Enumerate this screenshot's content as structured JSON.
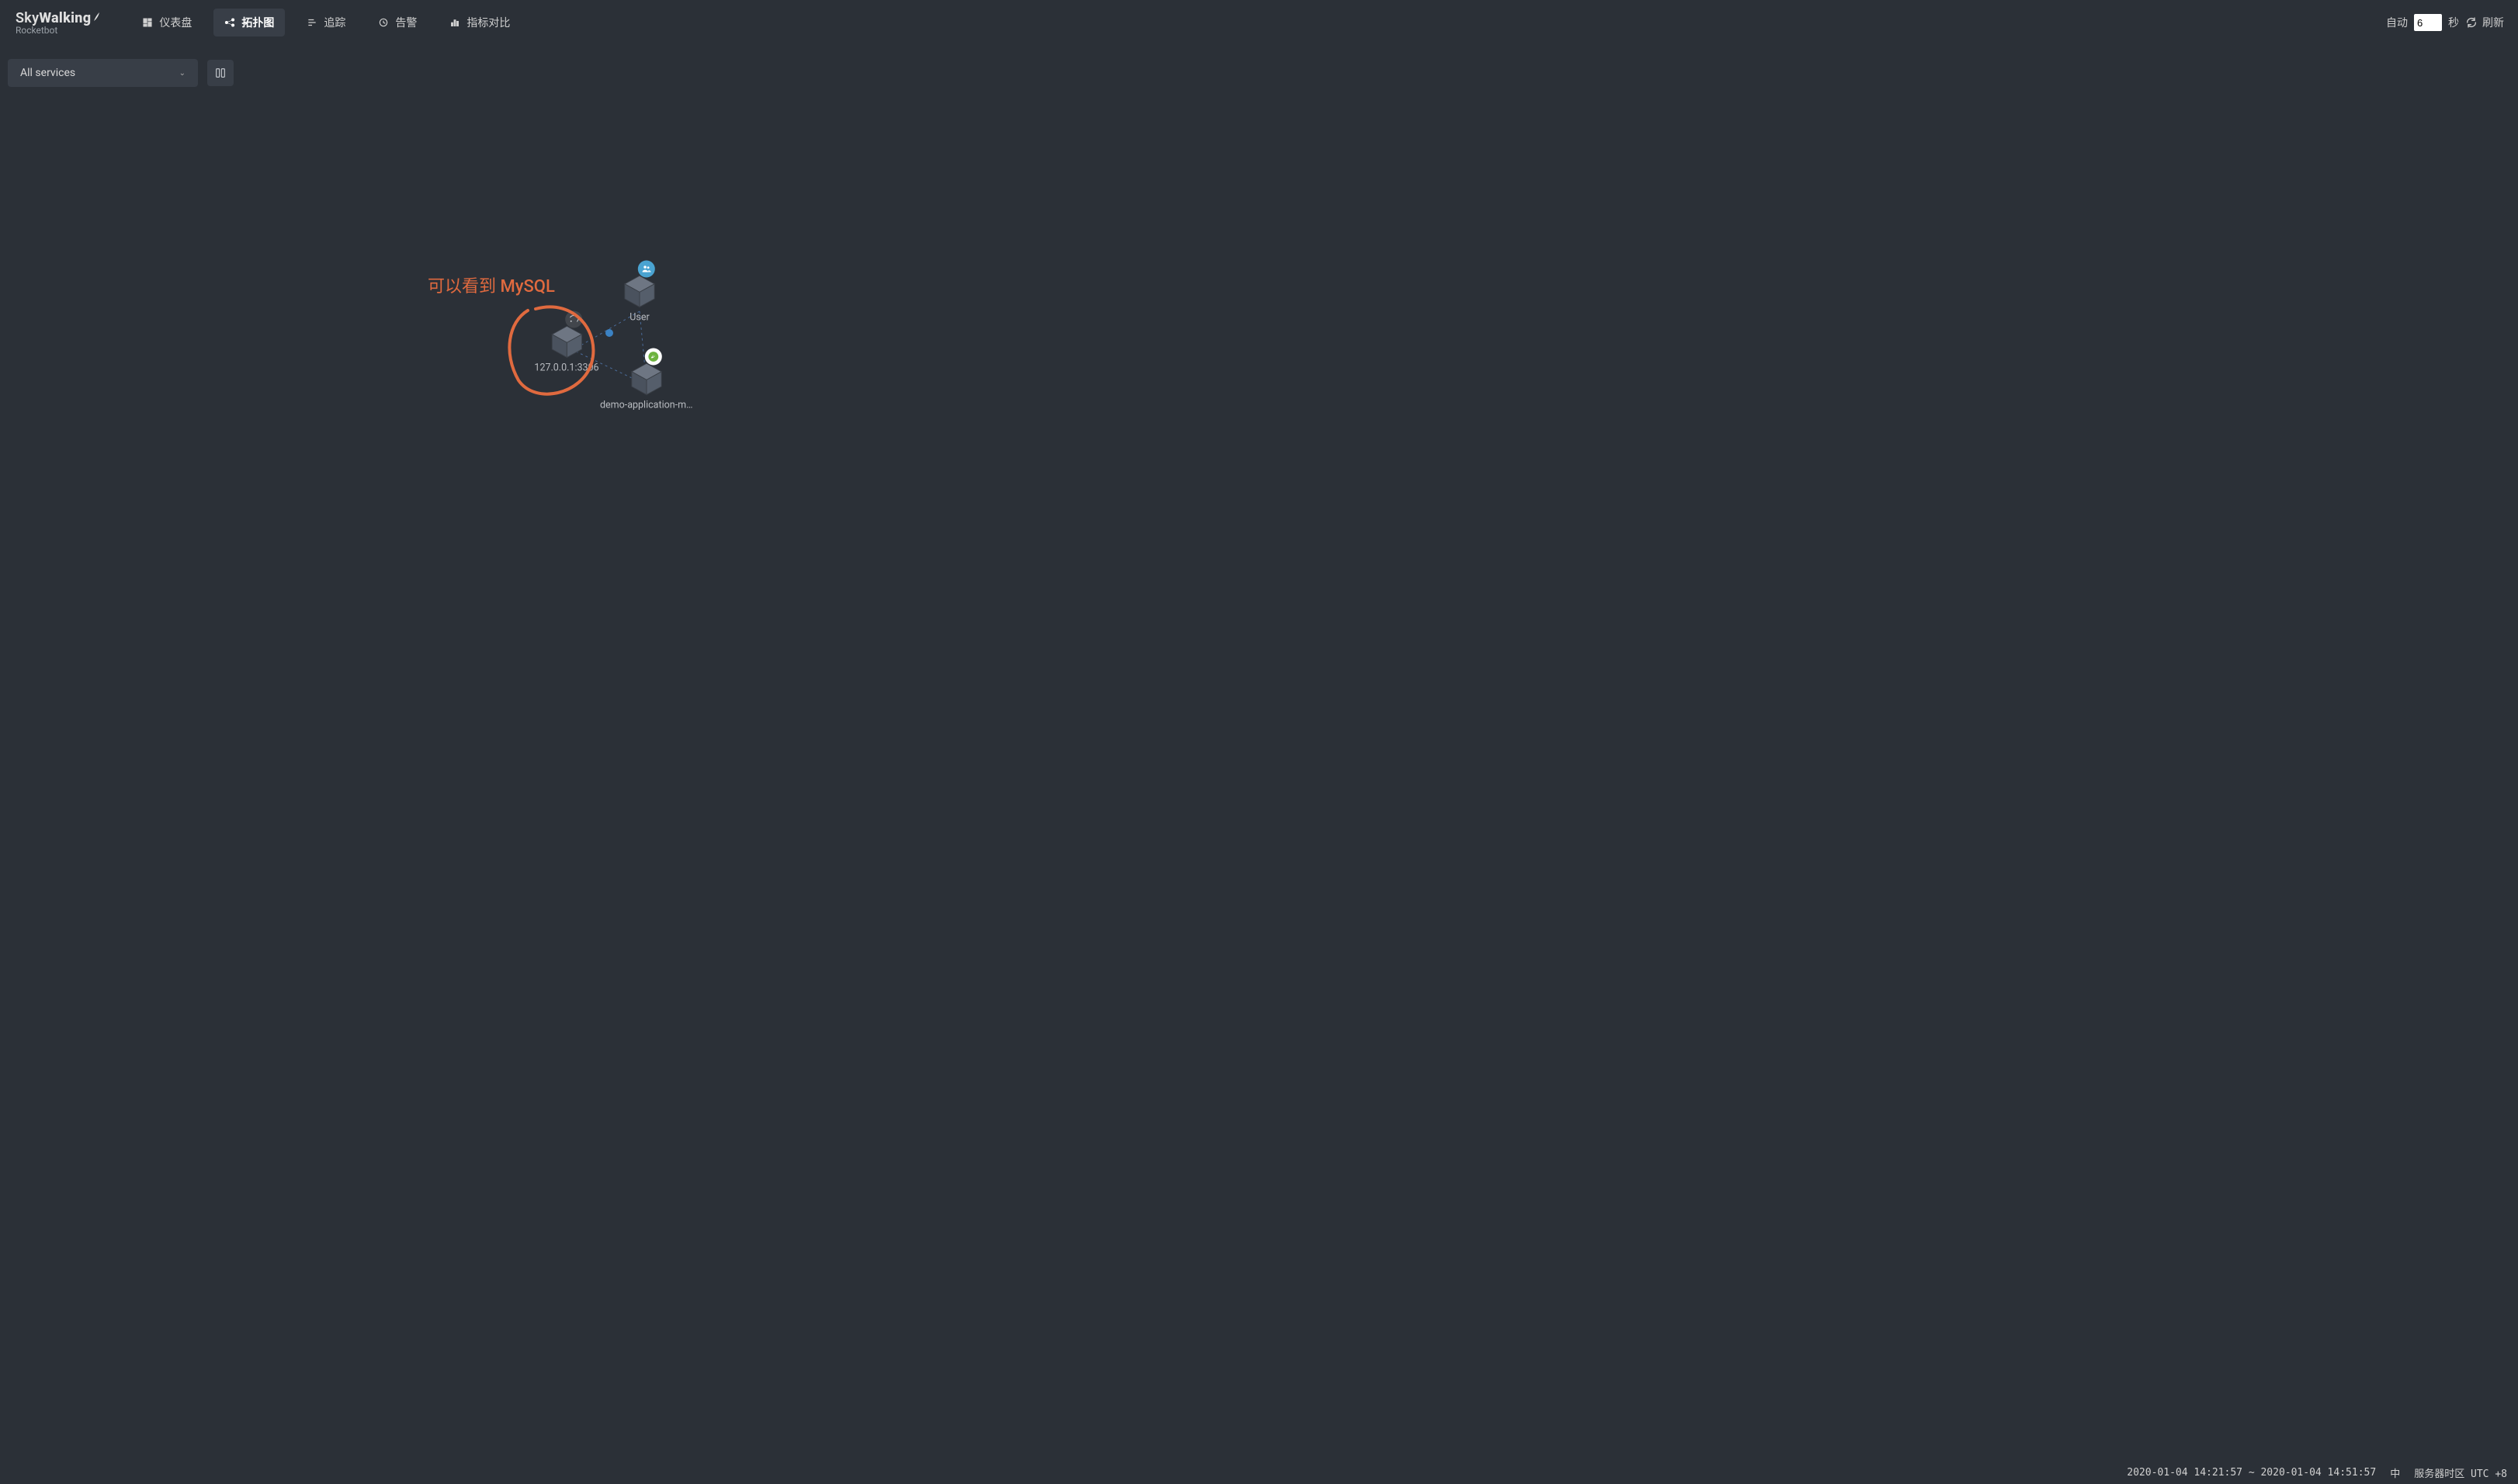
{
  "app": {
    "name_prefix": "Sky",
    "name_suffix": "Walking",
    "subtitle": "Rocketbot"
  },
  "nav": {
    "dashboard": "仪表盘",
    "topology": "拓扑图",
    "trace": "追踪",
    "alarm": "告警",
    "metrics_compare": "指标对比"
  },
  "refresh": {
    "auto_label": "自动",
    "interval_value": "6",
    "unit": "秒",
    "refresh_label": "刷新"
  },
  "toolbar": {
    "service_selector": "All services"
  },
  "annotation": {
    "text": "可以看到 MySQL"
  },
  "topology": {
    "nodes": {
      "user": {
        "label": "User"
      },
      "mysql": {
        "label": "127.0.0.1:3306"
      },
      "app": {
        "label": "demo-application-mys…"
      }
    }
  },
  "statusbar": {
    "timerange": "2020-01-04 14:21:57 ~ 2020-01-04 14:51:57",
    "lang": "中",
    "timezone": "服务器时区 UTC +8"
  },
  "colors": {
    "annotation": "#e06a3f",
    "edge": "#4a6b99",
    "traffic_dot": "#3b82c4"
  }
}
